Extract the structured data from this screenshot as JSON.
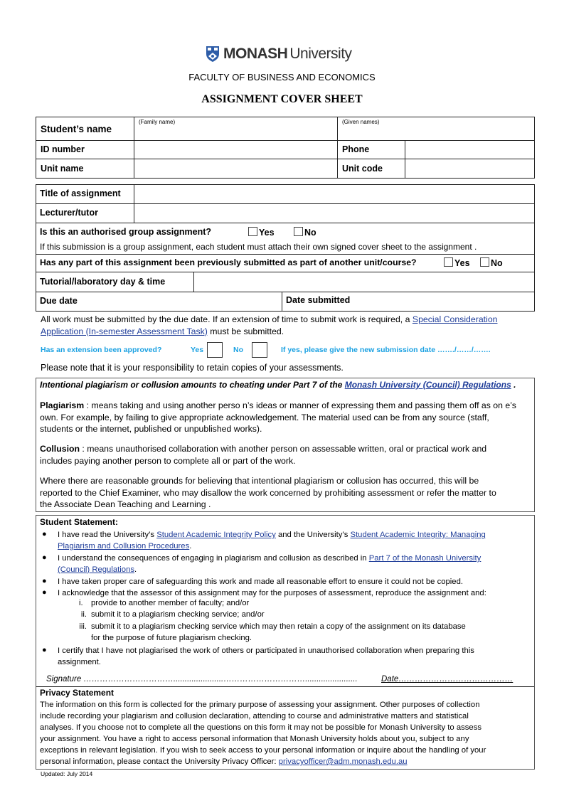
{
  "header": {
    "logo_bold": "MONASH",
    "logo_light": "University",
    "faculty": "FACULTY OF BUSINESS AND ECONOMICS",
    "title": "ASSIGNMENT COVER SHEET"
  },
  "student_table": {
    "student_name_label": "Student’s name",
    "family_name_hint": "(Family name)",
    "given_names_hint": "(Given names)",
    "id_label": "ID number",
    "phone_label": "Phone",
    "unit_name_label": "Unit name",
    "unit_code_label": "Unit code"
  },
  "assignment_table": {
    "title_label": "Title of assignment",
    "lecturer_label": "Lecturer/tutor",
    "group_question": "Is this an authorised group assignment?",
    "yes": "Yes",
    "no": "No",
    "group_note": "If this submission is a group assignment, each student must attach   their own signed cover sheet to the assignment .",
    "previous_question": "Has any part of this assignment been previously submitted as part of another unit/course?",
    "tutorial_label": "Tutorial/laboratory day & time",
    "due_date_label": "Due date",
    "date_submitted_label": "Date submitted"
  },
  "submission_note": {
    "text_before": "All work must be submitted by the due date.    If an extension of time to submit work is required, a  ",
    "link_line1": "Special Consideration",
    "link_line2": "Application (In-semester Assessment Task)",
    "text_after": " must be submitted."
  },
  "extension": {
    "question": "Has an extension been approved?",
    "yes": "Yes",
    "no": "No",
    "new_date": "If yes, please give the new submission date ……./……/……."
  },
  "retain_note": "Please note that it is your responsibility to retain copies of your assessments.",
  "plagiarism_box": {
    "intro": "Intentional plagiarism  or collusion  amounts to cheating  under Part 7 of the  ",
    "intro_link": "Monash University (Council) Regulations",
    "intro_end": " .",
    "plagiarism_term": "Plagiarism",
    "plagiarism_line1": " : means taking and using another perso n’s ideas or manner of expressing them and passing them off as on   e’s",
    "plagiarism_line2": "own. For example, by failing to give appropriate acknowledgement. The material used can be from any source (staff,",
    "plagiarism_line3": "students or the internet, published or unpublished works).",
    "collusion_term": "Collusion",
    "collusion_line1": " : means unauthorised collaboration with another person on assessable written, oral or practical work and",
    "collusion_line2": "includes paying another person to complete all or part of the work.",
    "grounds_line1": "Where there are reasonable grounds for believing that  intentional plagiarism or collusion has occurred, this will be",
    "grounds_line2": "reported to the Chief Examiner, who  may disallow the work concerned by prohibiting   assessment  or  refer the matter to",
    "grounds_line3": "the Associate Dean Teaching and Learning ."
  },
  "student_statement": {
    "heading": "Student Statement:",
    "item1_a": "I have read the University’s ",
    "item1_link1": "Student Academic Integrity Policy",
    "item1_b": " and the University’s ",
    "item1_link2a": "Student Academic Integrity: Managing",
    "item1_link2b": "Plagiarism and Collusion Procedures",
    "item1_end": ".",
    "item2_a": "I understand the consequences of engaging in plagiarism and collusion as described in ",
    "item2_link_a": "Part 7 of the Monash University",
    "item2_link_b": "(Council) Regulations",
    "item2_end": ".",
    "item3": "I have taken proper care of safeguarding this work and made all reasonable effort to ensure it could not be copied.",
    "item4": "I acknowledge that the assessor of this assignment may for the purposes of assessment, reproduce the assignment and:",
    "sub_items": [
      {
        "num": "i.",
        "text": "provide to another member of faculty; and/or"
      },
      {
        "num": "ii.",
        "text": "submit it to a plagiarism checking service; and/or"
      },
      {
        "num": "iii.",
        "text": "submit it to a plagiarism checking service which may then retain a copy of the assignment on its database"
      }
    ],
    "sub_item3_cont": "for the purpose of future plagiarism checking.",
    "item5_line1": "I certify that I have not plagiarised the work of others or participated in unauthorised collaboration when preparing this",
    "item5_line2": "assignment.",
    "signature": "Signature ……………………………......................………………………….......................",
    "date": "Date……………………………………"
  },
  "privacy": {
    "heading": "Privacy Statement",
    "line1": "The information on this form is collected for the primary purpose of assessing your assignment. Other purposes of collection",
    "line2": "include recording your plagiarism and collusion declaration, attending to course and administrative matters and statistical",
    "line3": "analyses. If you choose not to complete all the questions on this form it may not be possible for Monash University to assess",
    "line4": "your assignment. You have a right to access personal information that Monash University holds about you, subject to any",
    "line5": "exceptions in relevant legislation. If you wish to seek access to your personal information or inquire about the handling of your",
    "line6": "personal information, please contact the University Privacy Officer:  ",
    "email": "privacyofficer@adm.monash.edu.au"
  },
  "footer": {
    "updated": "Updated: July 2014"
  },
  "colors": {
    "link": "#1f3d99",
    "extension_text": "#1ba1e2",
    "logo_shield": "#2e5da8"
  }
}
